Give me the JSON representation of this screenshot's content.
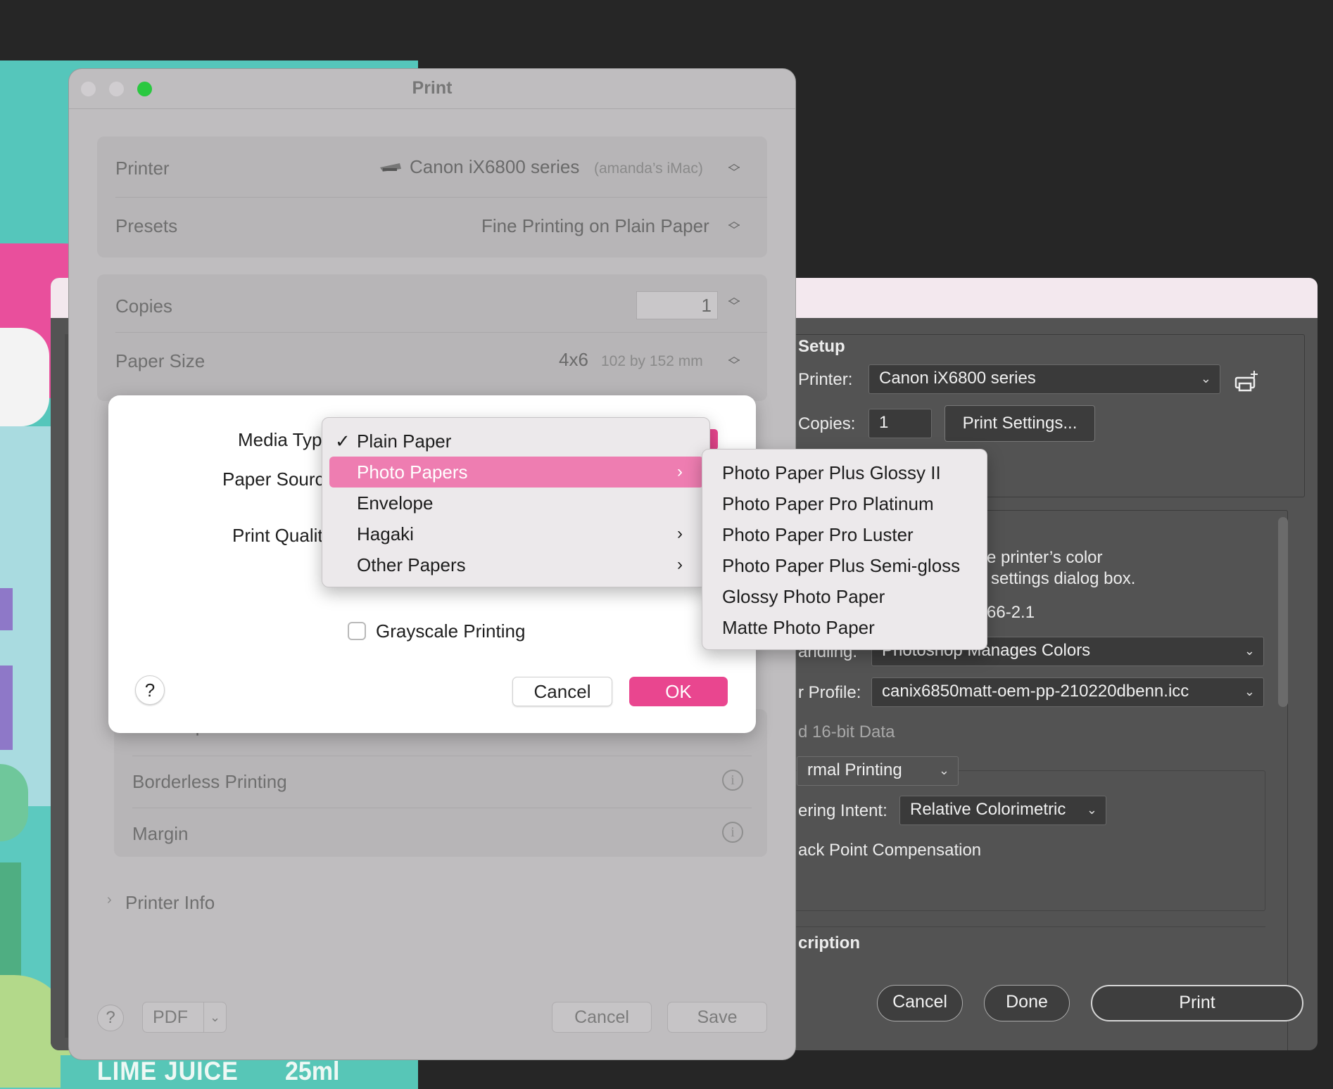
{
  "artwork": {
    "product_label": "LIME JUICE",
    "volume": "25ml"
  },
  "photoshop_dialog": {
    "section_title": "r Setup",
    "printer_label": "Printer:",
    "printer_value": "Canon iX6800 series",
    "copies_label": "Copies:",
    "copies_value": "1",
    "print_settings_button": "Print Settings...",
    "color_note_line1": "e printer’s color",
    "color_note_line2": "settings dialog box.",
    "profile_fragment": "66-2.1",
    "color_handling_label": "andling:",
    "color_handling_value": "Photoshop Manages Colors",
    "printer_profile_label": "r Profile:",
    "printer_profile_value": "canix6850matt-oem-pp-210220dbenn.icc",
    "send_16bit_label": "d 16-bit Data",
    "normal_printing_label": "rmal Printing",
    "rendering_intent_label": "ering Intent:",
    "rendering_intent_value": "Relative Colorimetric",
    "black_point_label": "ack Point Compensation",
    "description_label": "cription",
    "cancel_button": "Cancel",
    "done_button": "Done",
    "print_button": "Print"
  },
  "mac_print": {
    "title": "Print",
    "printer_label": "Printer",
    "printer_value": "Canon iX6800 series",
    "printer_host": "(amanda’s iMac)",
    "presets_label": "Presets",
    "presets_value": "Fine Printing on Plain Paper",
    "copies_label": "Copies",
    "copies_value": "1",
    "paper_size_label": "Paper Size",
    "paper_size_value": "4x6",
    "paper_size_dims": "102 by 152 mm",
    "color_options_label": "Color Options",
    "borderless_label": "Borderless Printing",
    "margin_label": "Margin",
    "printer_info_label": "Printer Info",
    "help": "?",
    "pdf_label": "PDF",
    "cancel_button": "Cancel",
    "save_button": "Save"
  },
  "sheet": {
    "media_type_label": "Media Typ",
    "paper_source_label": "Paper Sourc",
    "print_quality_label": "Print Qualit",
    "grayscale_label": "Grayscale Printing",
    "help": "?",
    "cancel_button": "Cancel",
    "ok_button": "OK"
  },
  "media_menu": {
    "checkmark": "✓",
    "items": [
      {
        "label": "Plain Paper",
        "checked": true,
        "submenu": false
      },
      {
        "label": "Photo Papers",
        "checked": false,
        "submenu": true,
        "highlighted": true
      },
      {
        "label": "Envelope",
        "checked": false,
        "submenu": false
      },
      {
        "label": "Hagaki",
        "checked": false,
        "submenu": true
      },
      {
        "label": "Other Papers",
        "checked": false,
        "submenu": true
      }
    ]
  },
  "photo_submenu": {
    "items": [
      "Photo Paper Plus Glossy II",
      "Photo Paper Pro Platinum",
      "Photo Paper Pro Luster",
      "Photo Paper Plus Semi-gloss",
      "Glossy Photo Paper",
      "Matte Photo Paper"
    ]
  },
  "colors": {
    "accent_pink": "#e9468f",
    "highlight_pink": "#ee7db1",
    "traffic_close": "#d0cdd0",
    "traffic_zoom": "#2ac840"
  }
}
